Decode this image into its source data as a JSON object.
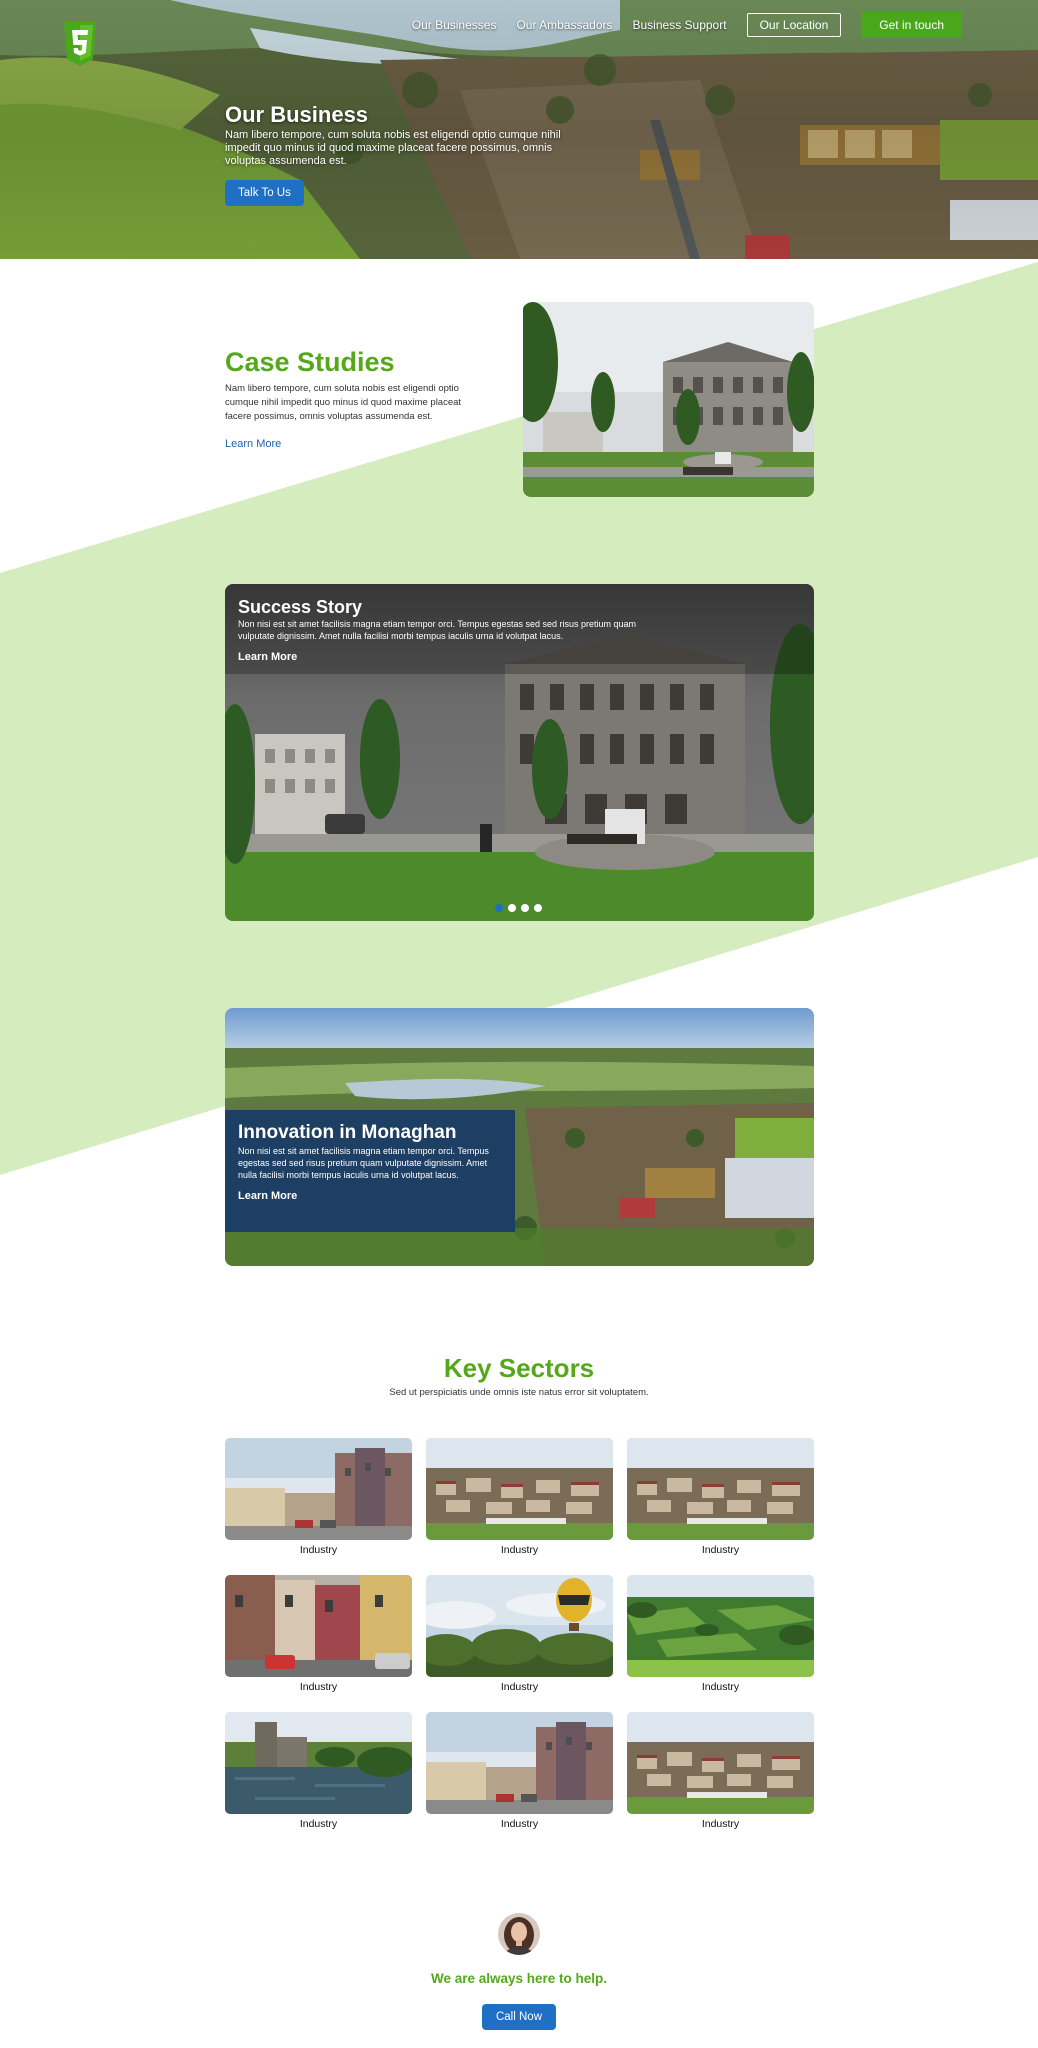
{
  "nav": {
    "items": [
      "Our Businesses",
      "Our Ambassadors",
      "Business Support"
    ],
    "location_label": "Our Location",
    "contact_label": "Get in touch"
  },
  "hero": {
    "title": "Our Business",
    "body": "Nam libero tempore, cum soluta nobis est eligendi optio cumque nihil impedit quo minus id quod maxime placeat facere possimus, omnis voluptas assumenda est.",
    "button": "Talk To Us"
  },
  "case_studies": {
    "title": "Case Studies",
    "body": "Nam libero tempore, cum soluta nobis est eligendi optio cumque nihil impedit quo minus id quod maxime placeat facere possimus, omnis voluptas assumenda est.",
    "link": "Learn More"
  },
  "success": {
    "title": "Success Story",
    "body": "Non nisi est sit amet facilisis magna etiam tempor orci. Tempus egestas sed sed risus pretium quam vulputate dignissim. Amet nulla facilisi morbi tempus iaculis urna id volutpat lacus.",
    "link": "Learn More",
    "slides": 4,
    "active_slide": 1
  },
  "innovation": {
    "title": "Innovation in Monaghan",
    "body": "Non nisi est sit amet facilisis magna etiam tempor orci. Tempus egestas sed sed risus pretium quam vulputate dignissim. Amet nulla facilisi morbi tempus iaculis urna id volutpat lacus.",
    "link": "Learn More"
  },
  "sectors": {
    "title": "Key Sectors",
    "subtitle": "Sed ut perspiciatis unde omnis iste natus error sit voluptatem.",
    "items": [
      {
        "label": "Industry",
        "scene": "street"
      },
      {
        "label": "Industry",
        "scene": "town"
      },
      {
        "label": "Industry",
        "scene": "town"
      },
      {
        "label": "Industry",
        "scene": "street2"
      },
      {
        "label": "Industry",
        "scene": "balloon"
      },
      {
        "label": "Industry",
        "scene": "fields"
      },
      {
        "label": "Industry",
        "scene": "castle"
      },
      {
        "label": "Industry",
        "scene": "street"
      },
      {
        "label": "Industry",
        "scene": "town"
      }
    ]
  },
  "help": {
    "title": "We are always here to help.",
    "button": "Call Now"
  },
  "colors": {
    "green": "#56a81b",
    "band": "#d5ecbf",
    "blue": "#1f6fc4",
    "navy": "#1d3f64"
  }
}
